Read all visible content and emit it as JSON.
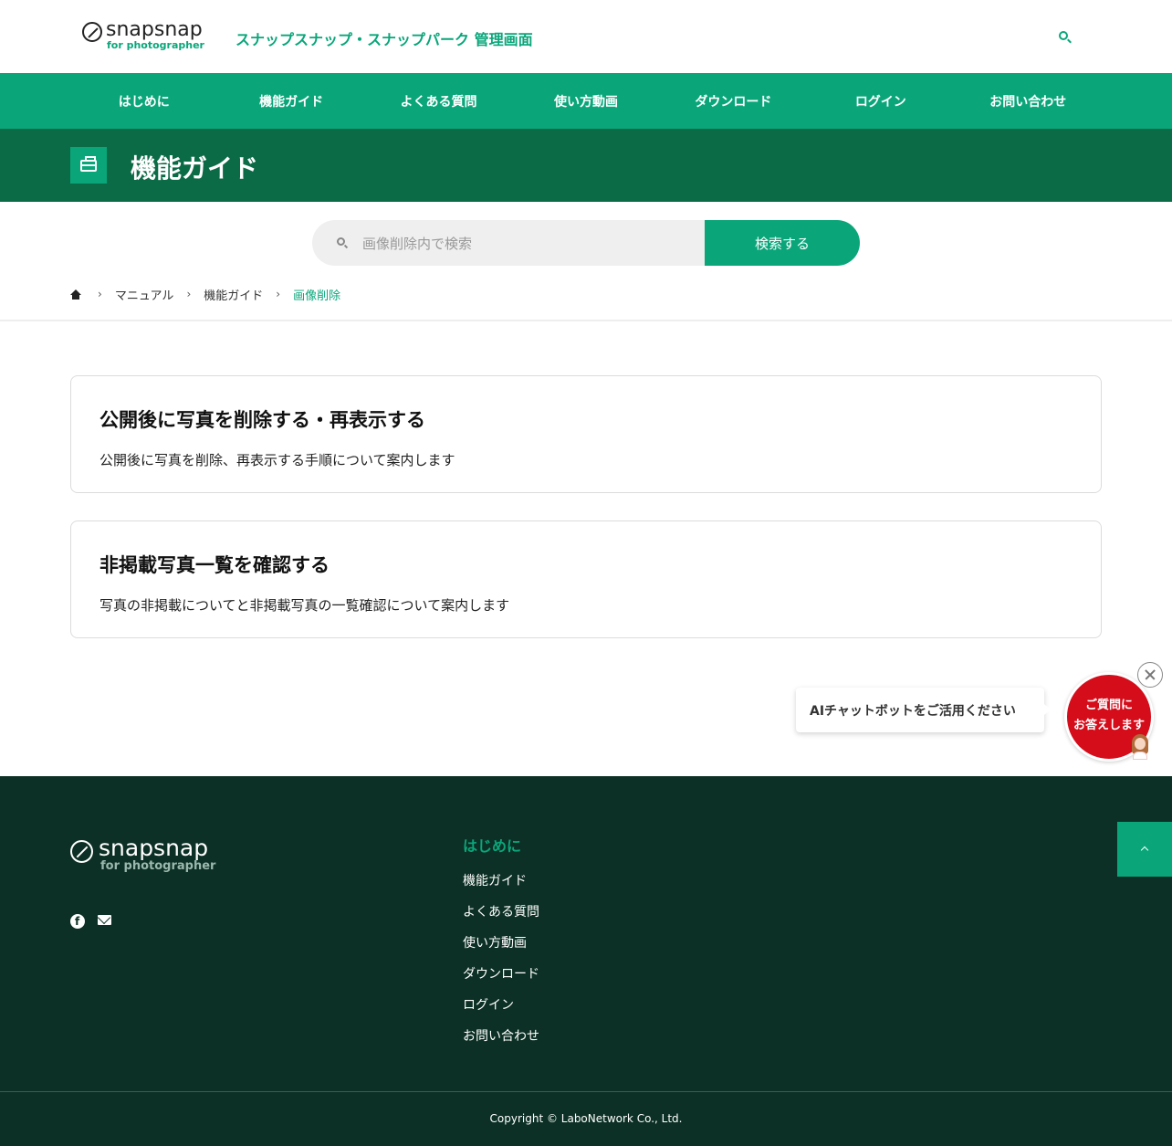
{
  "header": {
    "logo_word": "snapsnap",
    "logo_sub": "for photographer",
    "site_title": "スナップスナップ・スナップパーク 管理画面"
  },
  "nav": {
    "items": [
      {
        "label": "はじめに"
      },
      {
        "label": "機能ガイド"
      },
      {
        "label": "よくある質問"
      },
      {
        "label": "使い方動画"
      },
      {
        "label": "ダウンロード"
      },
      {
        "label": "ログイン"
      },
      {
        "label": "お問い合わせ"
      }
    ]
  },
  "banner": {
    "title": "機能ガイド",
    "icon": "toolbox-icon"
  },
  "search": {
    "placeholder": "画像削除内で検索",
    "button_label": "検索する"
  },
  "breadcrumb": {
    "items": [
      "マニュアル",
      "機能ガイド"
    ],
    "current": "画像削除",
    "separator": "›"
  },
  "cards": [
    {
      "title": "公開後に写真を削除する・再表示する",
      "description": "公開後に写真を削除、再表示する手順について案内します"
    },
    {
      "title": "非掲載写真一覧を確認する",
      "description": "写真の非掲載についてと非掲載写真の一覧確認について案内します"
    }
  ],
  "chat": {
    "bubble_text": "AIチャットボットをご活用ください",
    "circle_line1": "ご質問に",
    "circle_line2": "お答えします"
  },
  "footer": {
    "logo_word": "snapsnap",
    "logo_sub": "for photographer",
    "heading": "はじめに",
    "links": [
      "機能ガイド",
      "よくある質問",
      "使い方動画",
      "ダウンロード",
      "ログイン",
      "お問い合わせ"
    ],
    "copyright": "Copyright © LaboNetwork Co., Ltd."
  },
  "colors": {
    "accent": "#0aa67a",
    "banner": "#0c6b47",
    "footer": "#0c3025",
    "chat_red": "#d50d1b"
  }
}
